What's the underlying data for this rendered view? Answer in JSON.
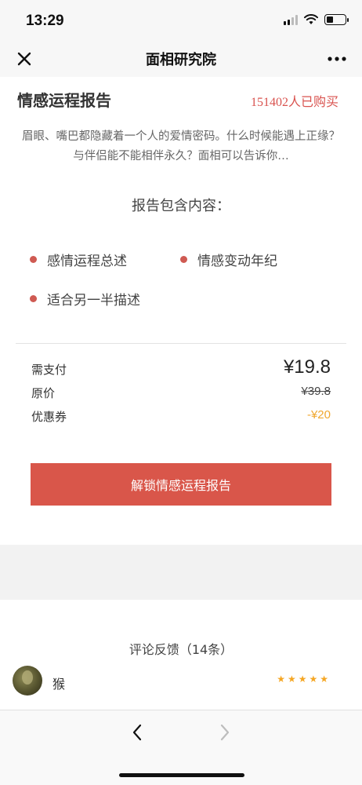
{
  "status_bar": {
    "time": "13:29"
  },
  "nav": {
    "title": "面相研究院"
  },
  "report": {
    "title": "情感运程报告",
    "buyers": "151402人已购买",
    "description": "眉眼、嘴巴都隐藏着一个人的爱情密码。什么时候能遇上正缘？与伴侣能不能相伴永久？面相可以告诉你…",
    "contains_title": "报告包含内容：",
    "items": [
      "感情运程总述",
      "情感变动年纪",
      "适合另一半描述"
    ]
  },
  "pricing": {
    "pay_label": "需支付",
    "pay_value": "¥19.8",
    "original_label": "原价",
    "original_value": "¥39.8",
    "coupon_label": "优惠券",
    "coupon_value": "-¥20",
    "unlock_button": "解锁情感运程报告"
  },
  "reviews": {
    "title": "评论反馈（14条）",
    "items": [
      {
        "name": "猴",
        "stars": "★★★★★",
        "rating": 5
      }
    ]
  },
  "colors": {
    "accent": "#d9564a",
    "coupon": "#f0a830",
    "star": "#f5a623"
  },
  "icons": {
    "close": "close-icon",
    "more": "more-icon",
    "back": "chevron-left-icon",
    "forward": "chevron-right-icon"
  }
}
